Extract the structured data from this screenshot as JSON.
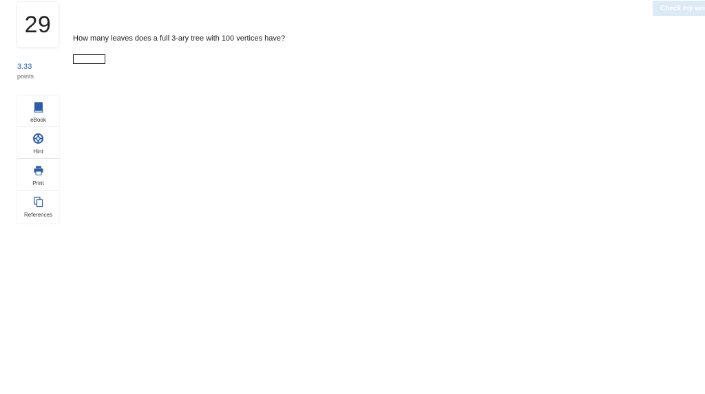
{
  "question": {
    "number": "29",
    "points_value": "3.33",
    "points_label": "points",
    "text": "How many leaves does a full 3-ary tree with 100 vertices have?",
    "answer_value": ""
  },
  "header": {
    "check_button_label": "Check my work"
  },
  "tools": [
    {
      "label": "eBook",
      "icon": "book-icon"
    },
    {
      "label": "Hint",
      "icon": "lifebuoy-icon"
    },
    {
      "label": "Print",
      "icon": "printer-icon"
    },
    {
      "label": "References",
      "icon": "copy-icon"
    }
  ],
  "colors": {
    "accent": "#1d5fb0",
    "check_button_bg": "#dce9f6"
  }
}
